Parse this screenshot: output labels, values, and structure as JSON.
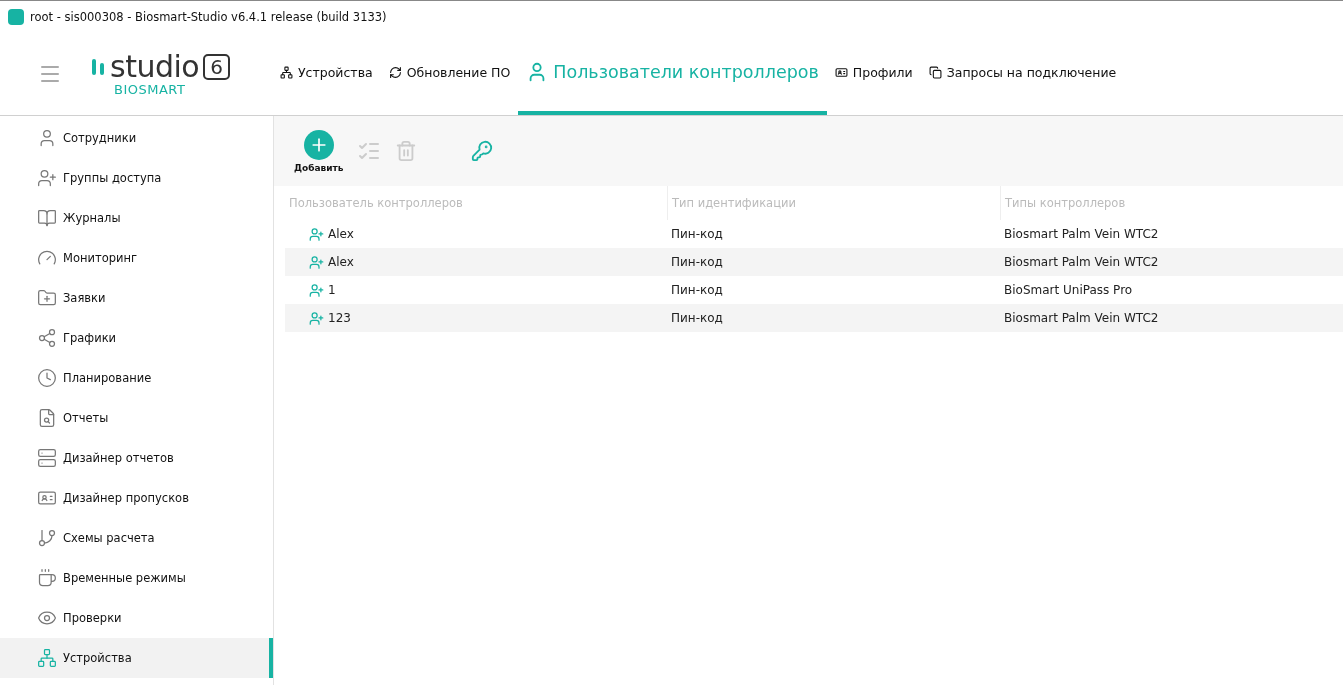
{
  "window": {
    "title": "root - sis000308 - Biosmart-Studio v6.4.1 release (build 3133)"
  },
  "logo": {
    "word": "studio",
    "version": "6",
    "brand": "BIOSMART"
  },
  "nav": [
    {
      "label": "Устройства",
      "selected": false
    },
    {
      "label": "Обновление ПО",
      "selected": false
    },
    {
      "label": "Пользователи контроллеров",
      "selected": true
    },
    {
      "label": "Профили",
      "selected": false
    },
    {
      "label": "Запросы на подключение",
      "selected": false
    }
  ],
  "sidebar": {
    "items": [
      {
        "label": "Сотрудники",
        "selected": false
      },
      {
        "label": "Группы доступа",
        "selected": false
      },
      {
        "label": "Журналы",
        "selected": false
      },
      {
        "label": "Мониторинг",
        "selected": false
      },
      {
        "label": "Заявки",
        "selected": false
      },
      {
        "label": "Графики",
        "selected": false
      },
      {
        "label": "Планирование",
        "selected": false
      },
      {
        "label": "Отчеты",
        "selected": false
      },
      {
        "label": "Дизайнер отчетов",
        "selected": false
      },
      {
        "label": "Дизайнер пропусков",
        "selected": false
      },
      {
        "label": "Схемы расчета",
        "selected": false
      },
      {
        "label": "Временные режимы",
        "selected": false
      },
      {
        "label": "Проверки",
        "selected": false
      },
      {
        "label": "Устройства",
        "selected": true
      }
    ]
  },
  "toolbar": [
    {
      "kind": "add",
      "label": "Добавить",
      "disabled": false
    },
    {
      "kind": "assign",
      "disabled": true
    },
    {
      "kind": "delete",
      "disabled": true
    },
    {
      "kind": "key",
      "disabled": false
    }
  ],
  "table": {
    "columns": [
      "Пользователь контроллеров",
      "Тип идентификации",
      "Типы контроллеров"
    ],
    "rows": [
      [
        "Alex",
        "Пин-код",
        "Biosmart Palm Vein WTC2"
      ],
      [
        "Alex",
        "Пин-код",
        "Biosmart Palm Vein WTC2"
      ],
      [
        "1",
        "Пин-код",
        "BioSmart UniPass Pro"
      ],
      [
        "123",
        "Пин-код",
        "Biosmart Palm Vein WTC2"
      ]
    ]
  }
}
